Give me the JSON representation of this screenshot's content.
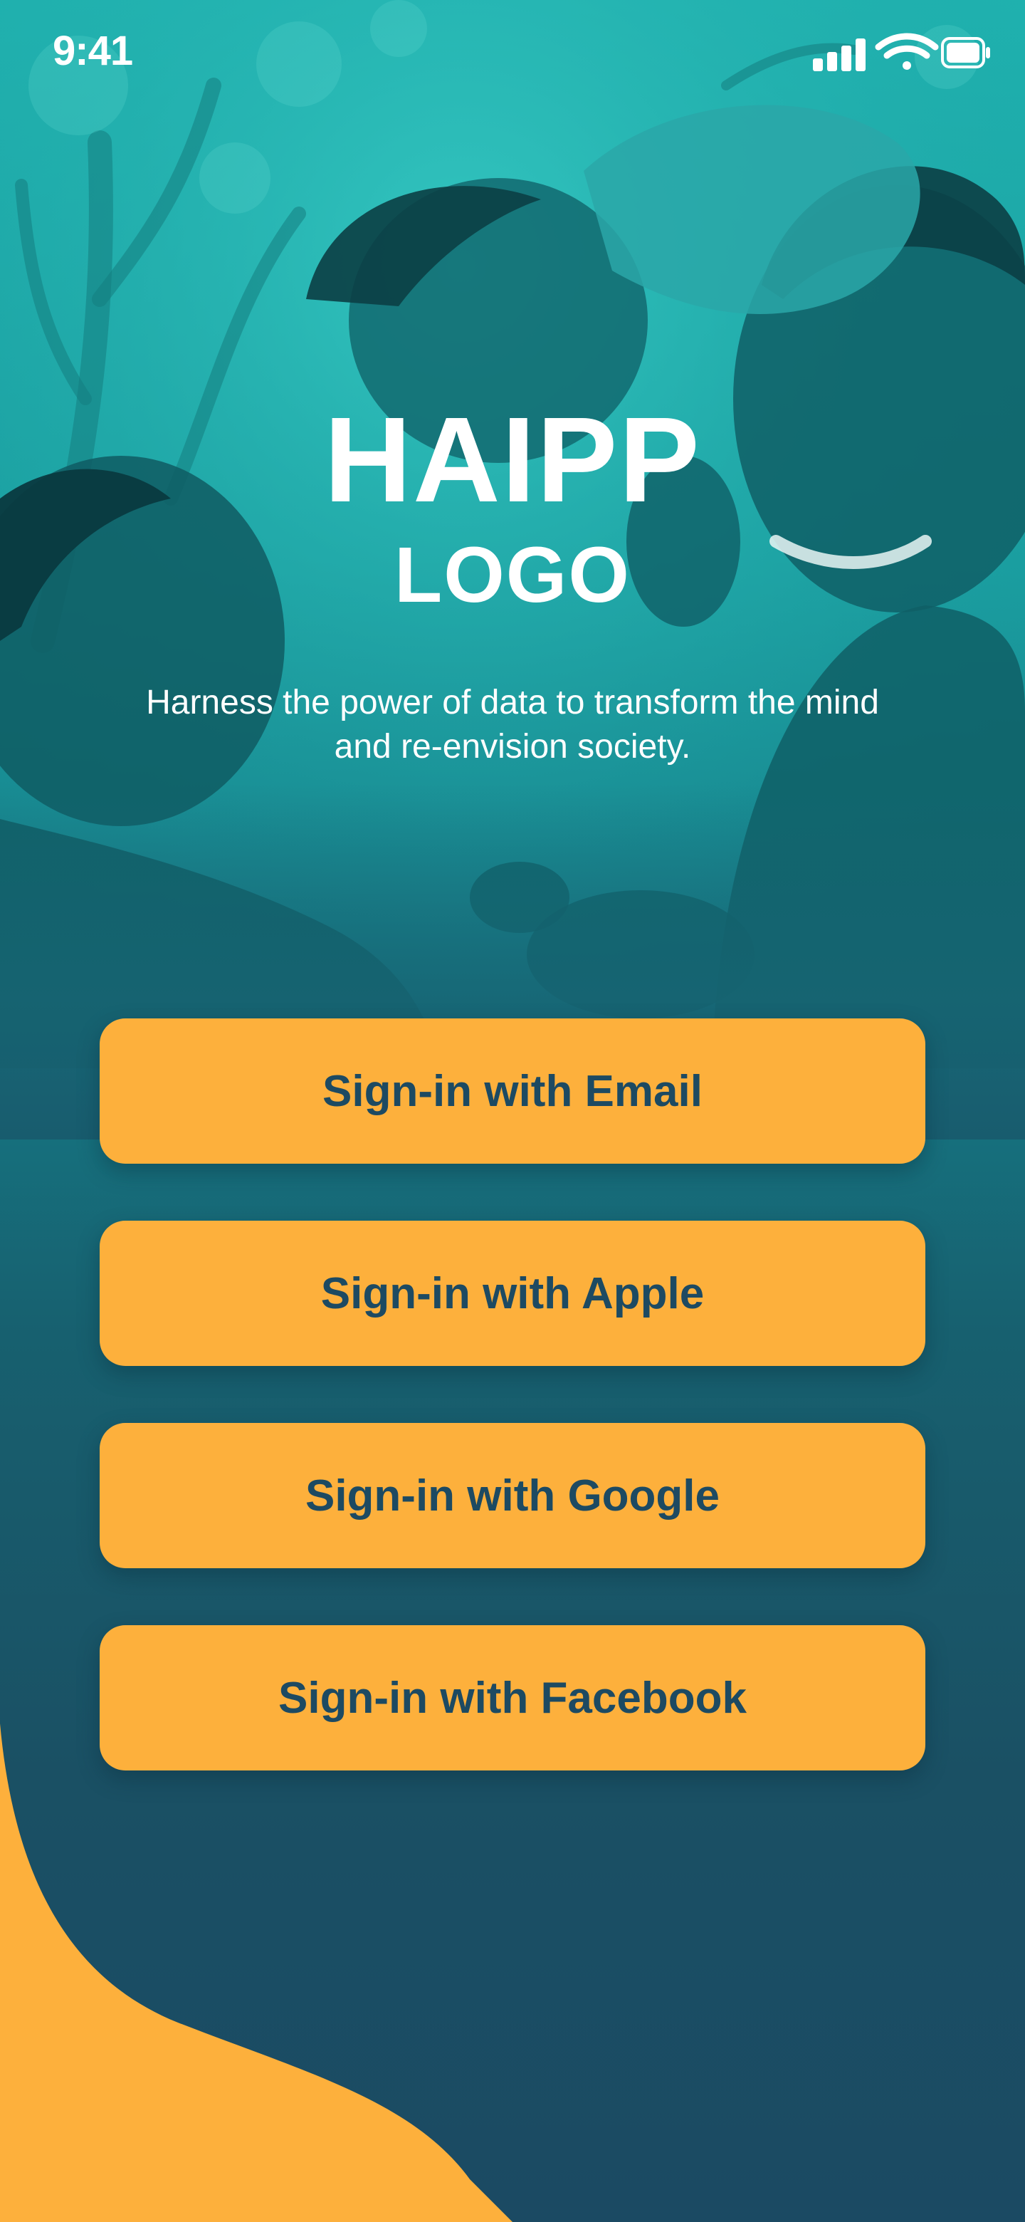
{
  "status_bar": {
    "time": "9:41",
    "icons": [
      "signal-icon",
      "wifi-icon",
      "battery-icon"
    ]
  },
  "brand": {
    "title": "HAIPP",
    "subtitle": "LOGO",
    "tagline": "Harness the power of data to transform the mind and re-envision society."
  },
  "auth": {
    "buttons": [
      {
        "label": "Sign-in with Email"
      },
      {
        "label": "Sign-in with Apple"
      },
      {
        "label": "Sign-in with Google"
      },
      {
        "label": "Sign-in with Facebook"
      }
    ]
  },
  "colors": {
    "accent": "#fdb03c",
    "button_text": "#1d4a62",
    "background_top": "#1fb3b0",
    "background_bottom": "#1b4a63"
  }
}
